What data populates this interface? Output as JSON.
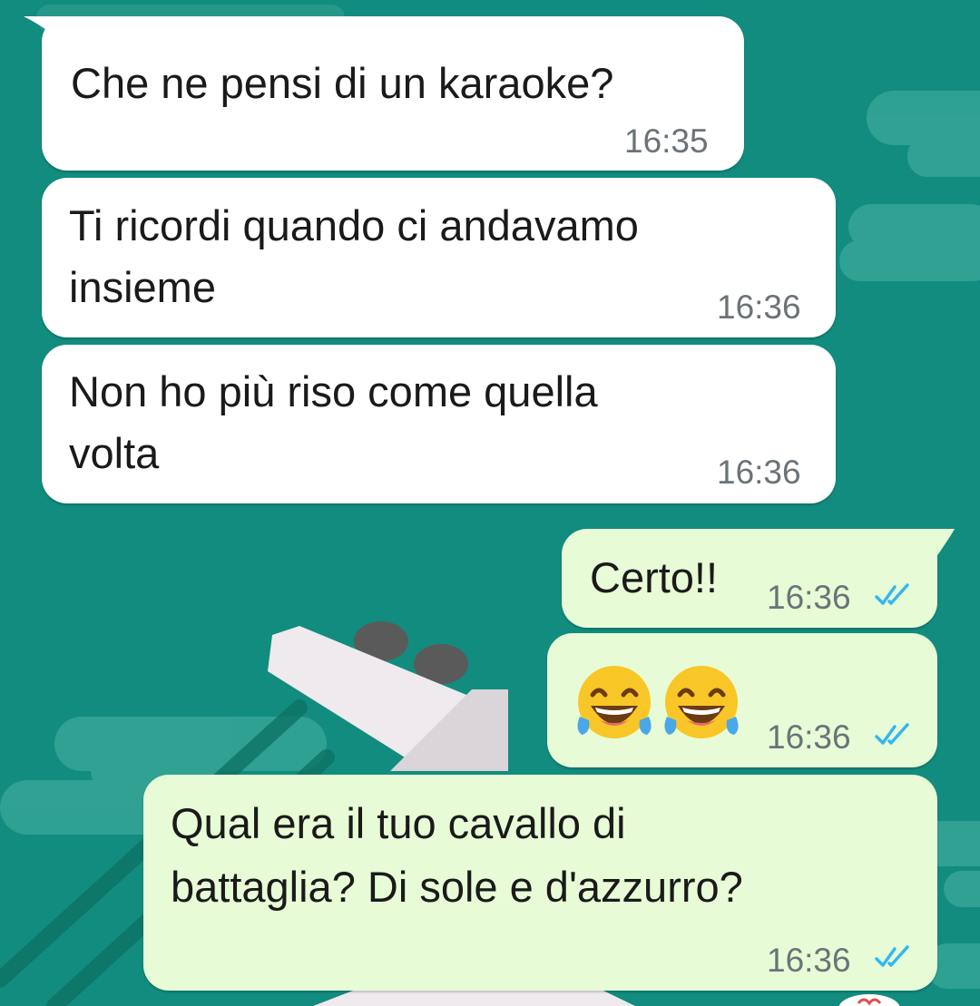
{
  "chat": {
    "messages": [
      {
        "direction": "incoming",
        "text": "Che ne pensi di un karaoke?",
        "time": "16:35"
      },
      {
        "direction": "incoming",
        "text_lines": [
          "Ti ricordi quando ci andavamo",
          "insieme"
        ],
        "time": "16:36"
      },
      {
        "direction": "incoming",
        "text_lines": [
          "Non ho più riso come quella",
          "volta"
        ],
        "time": "16:36"
      },
      {
        "direction": "outgoing",
        "text": "Certo!!",
        "time": "16:36",
        "status": "read"
      },
      {
        "direction": "outgoing",
        "emoji": [
          "face-with-tears-of-joy",
          "face-with-tears-of-joy"
        ],
        "time": "16:36",
        "status": "read"
      },
      {
        "direction": "outgoing",
        "text_lines": [
          "Qual era il tuo cavallo di",
          "battaglia? Di sole e d'azzurro?"
        ],
        "time": "16:36",
        "status": "read"
      }
    ]
  },
  "colors": {
    "wallpaper": "#128c7e",
    "incoming_bubble": "#ffffff",
    "outgoing_bubble": "#e7fcd6",
    "read_ticks": "#34b7f1",
    "timestamp": "#6b7378"
  },
  "icons": {
    "read_status": "double-check-icon",
    "emoji": "face-with-tears-of-joy"
  }
}
